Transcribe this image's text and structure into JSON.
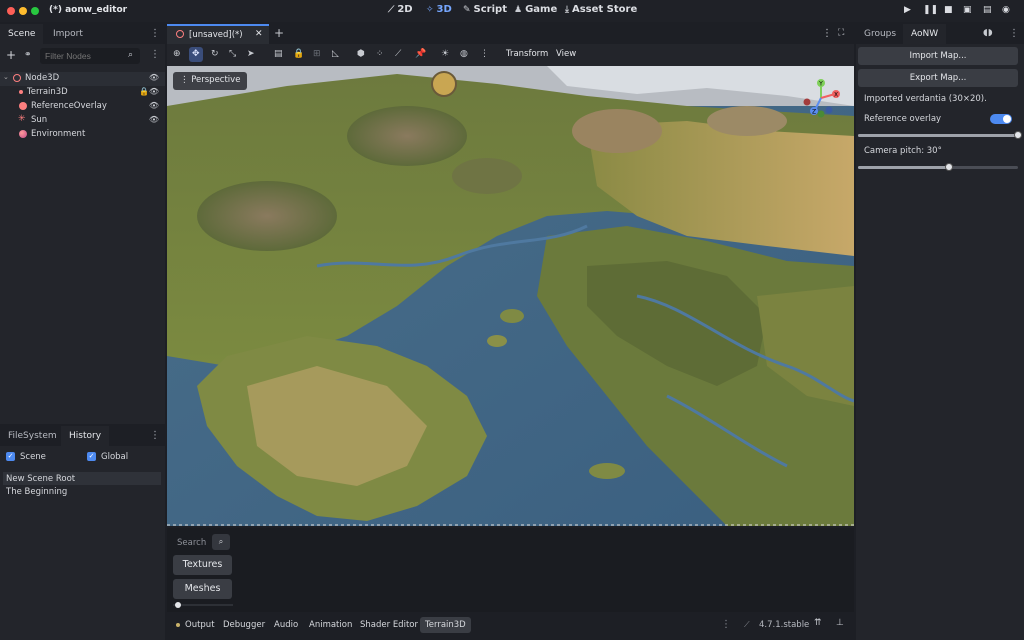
{
  "window": {
    "title": "(*) aonw_editor"
  },
  "workspaces": [
    {
      "label": "2D",
      "icon": "2d-icon"
    },
    {
      "label": "3D",
      "icon": "3d-icon",
      "active": true
    },
    {
      "label": "Script",
      "icon": "script-icon"
    },
    {
      "label": "Game",
      "icon": "game-icon"
    },
    {
      "label": "Asset Store",
      "icon": "asset-store-icon"
    }
  ],
  "scene_dock": {
    "tabs": [
      "Scene",
      "Import"
    ],
    "filter_placeholder": "Filter Nodes",
    "nodes": [
      {
        "label": "Node3D",
        "icon": "node3d-icon",
        "color": "#fc7f7f",
        "visible": true
      },
      {
        "label": "Terrain3D",
        "icon": "terrain3d-icon",
        "color": "#fc7f7f",
        "locked": true,
        "visible": true
      },
      {
        "label": "ReferenceOverlay",
        "icon": "mesh-instance-icon",
        "color": "#fc7f7f",
        "visible": true
      },
      {
        "label": "Sun",
        "icon": "sun-icon",
        "color": "#fc7f7f",
        "visible": true
      },
      {
        "label": "Environment",
        "icon": "environment-icon",
        "color": "#fc7f7f"
      }
    ]
  },
  "history_dock": {
    "tabs": [
      "FileSystem",
      "History"
    ],
    "active_tab": "History",
    "checks": [
      {
        "label": "Scene",
        "checked": true
      },
      {
        "label": "Global",
        "checked": true
      }
    ],
    "entries": [
      "New Scene Root",
      "The Beginning"
    ]
  },
  "editor_tab": {
    "label": "[unsaved](*)"
  },
  "viewport_menu": {
    "transform": "Transform",
    "view": "View"
  },
  "viewport": {
    "perspective_label": "Perspective",
    "gizmo_axes": [
      "Y",
      "X",
      "Z"
    ]
  },
  "bottom_panel": {
    "search_label": "Search",
    "buttons": [
      "Textures",
      "Meshes"
    ],
    "tabs": [
      "Output",
      "Debugger",
      "Audio",
      "Animation",
      "Shader Editor",
      "Terrain3D"
    ],
    "active_tab": "Terrain3D",
    "version": "4.7.1.stable"
  },
  "right_dock": {
    "tabs": [
      "Groups",
      "AoNW"
    ],
    "active_tab": "AoNW",
    "import_button": "Import Map...",
    "export_button": "Export Map...",
    "status": "Imported verdantia (30×20).",
    "overlay_label": "Reference overlay",
    "overlay_on": true,
    "overlay_value": 1.0,
    "pitch_label": "Camera pitch: 30°",
    "pitch_value": 0.57
  },
  "colors": {
    "accent": "#4d8af0",
    "bg": "#1d1f25",
    "panel": "#23252b"
  }
}
